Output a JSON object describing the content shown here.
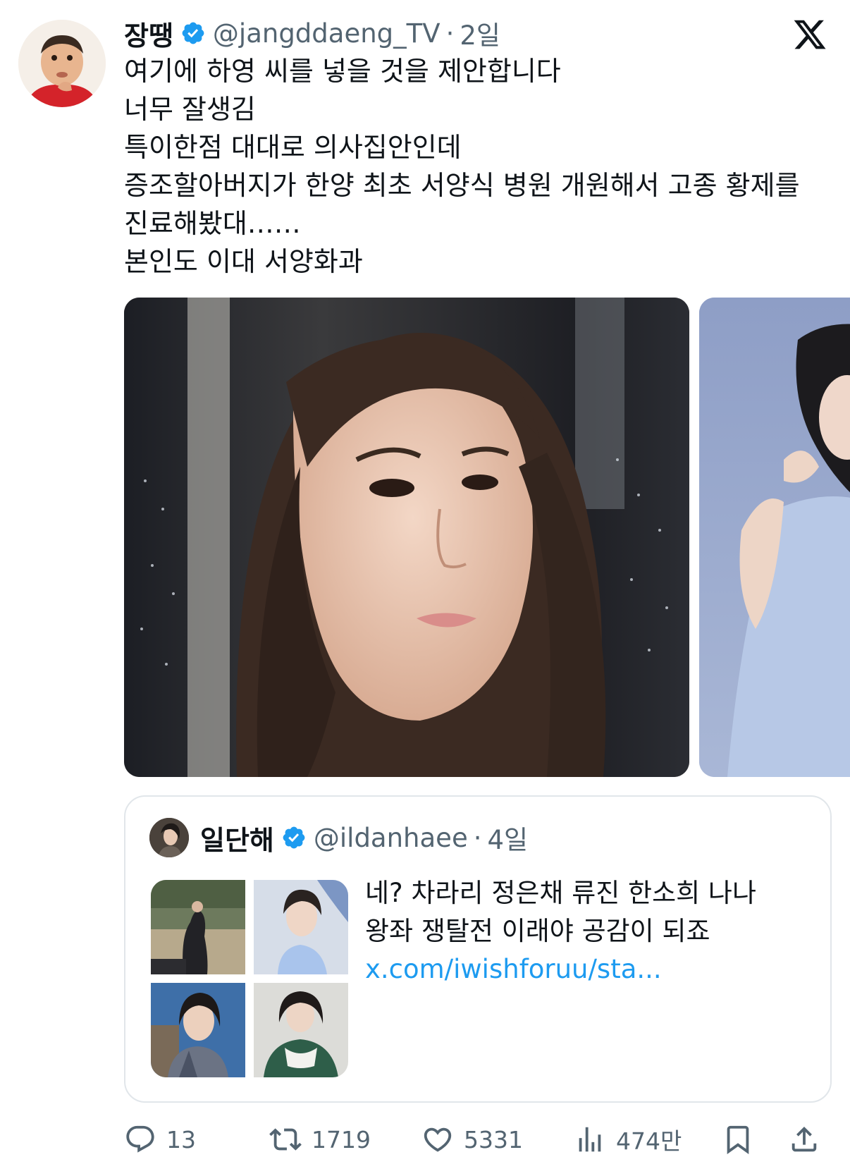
{
  "post": {
    "display_name": "장땡",
    "handle": "@jangddaeng_TV",
    "separator": "·",
    "time": "2일",
    "text_lines": [
      "여기에 하영 씨를 넣을 것을 제안합니다",
      "너무 잘생김",
      "특이한점 대대로 의사집안인데",
      "증조할아버지가 한양 최초 서양식 병원 개원해서 고종 황제를",
      "진료해봤대……",
      "본인도 이대 서양화과"
    ]
  },
  "quoted_post": {
    "display_name": "일단해",
    "handle": "@ildanhaee",
    "separator": "·",
    "time": "4일",
    "text_lines": [
      "네? 차라리 정은채 류진 한소희 나나",
      "왕좌 쟁탈전 이래야 공감이 되죠"
    ],
    "link": "x.com/iwishforuu/sta..."
  },
  "actions": {
    "replies": "13",
    "reposts": "1719",
    "likes": "5331",
    "views": "474만"
  },
  "icons": {
    "verified": "verified-badge-icon",
    "brand": "x-logo-icon",
    "reply": "reply-icon",
    "repost": "repost-icon",
    "like": "heart-icon",
    "views": "views-icon",
    "bookmark": "bookmark-icon",
    "share": "share-icon"
  },
  "colors": {
    "text": "#0f1419",
    "secondary": "#536471",
    "accent": "#1d9bf0",
    "border": "#e1e6ea"
  }
}
